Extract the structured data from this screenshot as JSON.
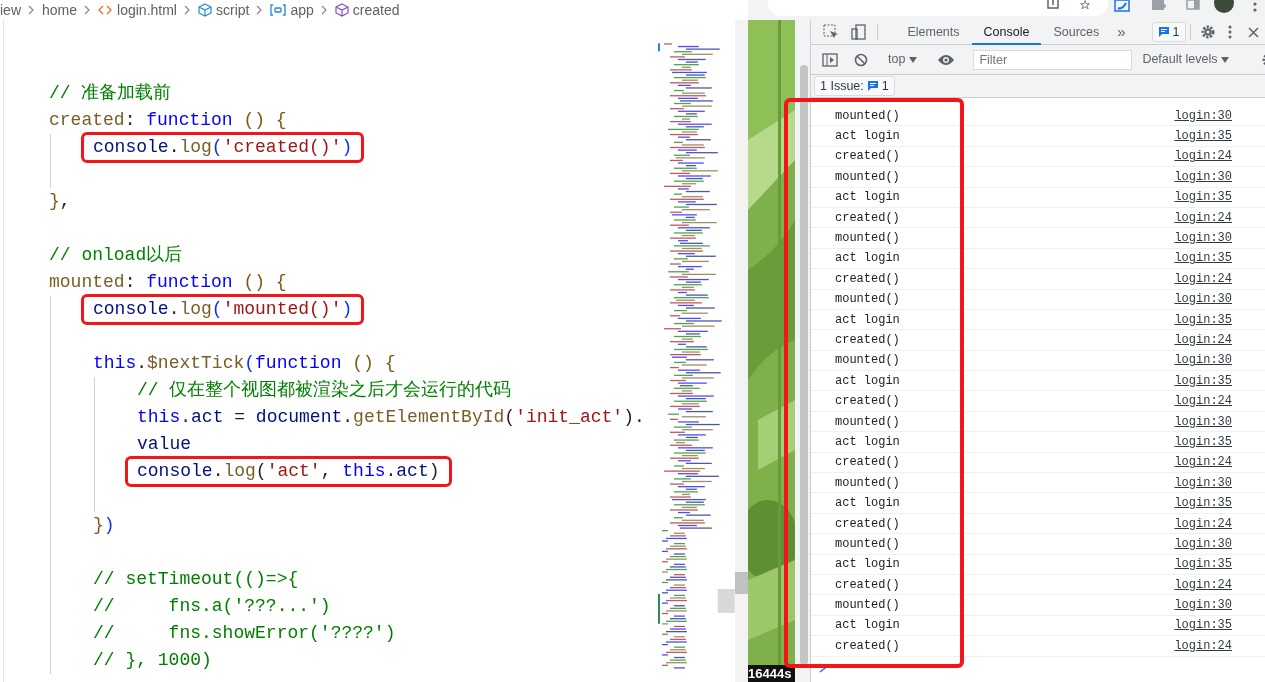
{
  "breadcrumb": [
    {
      "kind": "text",
      "label": "iew"
    },
    {
      "kind": "text",
      "label": "home"
    },
    {
      "kind": "html",
      "label": "login.html"
    },
    {
      "kind": "module",
      "label": "script"
    },
    {
      "kind": "variable",
      "label": "app"
    },
    {
      "kind": "method",
      "label": "created"
    }
  ],
  "code": [
    {
      "kind": "code",
      "highlighted": false,
      "tokens": [
        {
          "kind": "comment",
          "text": "// 准备加载前"
        }
      ]
    },
    {
      "kind": "code",
      "highlighted": false,
      "tokens": [
        {
          "kind": "key",
          "text": "created"
        },
        {
          "kind": "punct",
          "text": ": "
        },
        {
          "kind": "keyword",
          "text": "function"
        },
        {
          "kind": "paren",
          "text": " () {"
        }
      ],
      "children": [
        {
          "kind": "code",
          "highlighted": true,
          "tokens": [
            {
              "kind": "ident",
              "text": "console"
            },
            {
              "kind": "punct",
              "text": "."
            },
            {
              "kind": "method",
              "text": "log"
            },
            {
              "kind": "bracket",
              "text": "("
            },
            {
              "kind": "string",
              "text": "'created()'"
            },
            {
              "kind": "bracket",
              "text": ")"
            }
          ]
        },
        {
          "kind": "blank"
        }
      ]
    },
    {
      "kind": "code",
      "highlighted": false,
      "tokens": [
        {
          "kind": "paren",
          "text": "}"
        },
        {
          "kind": "punct",
          "text": ","
        }
      ]
    },
    {
      "kind": "blank"
    },
    {
      "kind": "code",
      "highlighted": false,
      "tokens": [
        {
          "kind": "comment",
          "text": "// onload以后"
        }
      ]
    },
    {
      "kind": "code",
      "highlighted": false,
      "tokens": [
        {
          "kind": "key",
          "text": "mounted"
        },
        {
          "kind": "punct",
          "text": ": "
        },
        {
          "kind": "keyword",
          "text": "function"
        },
        {
          "kind": "paren",
          "text": " () {"
        }
      ],
      "children": [
        {
          "kind": "code",
          "highlighted": true,
          "tokens": [
            {
              "kind": "ident",
              "text": "console"
            },
            {
              "kind": "punct",
              "text": "."
            },
            {
              "kind": "method",
              "text": "log"
            },
            {
              "kind": "bracket",
              "text": "("
            },
            {
              "kind": "string",
              "text": "'mounted()'"
            },
            {
              "kind": "bracket",
              "text": ")"
            }
          ]
        },
        {
          "kind": "blank"
        },
        {
          "kind": "code",
          "highlighted": false,
          "tokens": [
            {
              "kind": "keyword",
              "text": "this"
            },
            {
              "kind": "punct",
              "text": "."
            },
            {
              "kind": "method",
              "text": "$nextTick"
            },
            {
              "kind": "bracket",
              "text": "("
            },
            {
              "kind": "keyword",
              "text": "function"
            },
            {
              "kind": "paren",
              "text": " () {"
            }
          ],
          "children": [
            {
              "kind": "code",
              "highlighted": false,
              "tokens": [
                {
                  "kind": "comment",
                  "text": "// 仅在整个视图都被渲染之后才会运行的代码"
                }
              ]
            },
            {
              "kind": "code",
              "highlighted": false,
              "tokens": [
                {
                  "kind": "keyword",
                  "text": "this"
                },
                {
                  "kind": "punct",
                  "text": "."
                },
                {
                  "kind": "ident",
                  "text": "act"
                },
                {
                  "kind": "punct",
                  "text": " = "
                },
                {
                  "kind": "ident",
                  "text": "document"
                },
                {
                  "kind": "punct",
                  "text": "."
                },
                {
                  "kind": "method",
                  "text": "getElementById"
                },
                {
                  "kind": "punct",
                  "text": "("
                },
                {
                  "kind": "string",
                  "text": "'init_act'"
                },
                {
                  "kind": "punct",
                  "text": ")."
                }
              ]
            },
            {
              "kind": "code",
              "highlighted": false,
              "tokens": [
                {
                  "kind": "ident",
                  "text": "value"
                }
              ]
            },
            {
              "kind": "code",
              "highlighted": true,
              "tokens": [
                {
                  "kind": "ident",
                  "text": "console"
                },
                {
                  "kind": "punct",
                  "text": "."
                },
                {
                  "kind": "method",
                  "text": "log"
                },
                {
                  "kind": "punct",
                  "text": "("
                },
                {
                  "kind": "string",
                  "text": "'act'"
                },
                {
                  "kind": "punct",
                  "text": ", "
                },
                {
                  "kind": "keyword",
                  "text": "this"
                },
                {
                  "kind": "punct",
                  "text": "."
                },
                {
                  "kind": "ident",
                  "text": "act"
                },
                {
                  "kind": "punct",
                  "text": ")"
                }
              ]
            },
            {
              "kind": "blank"
            }
          ]
        },
        {
          "kind": "code",
          "highlighted": false,
          "tokens": [
            {
              "kind": "paren",
              "text": "}"
            },
            {
              "kind": "bracket",
              "text": ")"
            }
          ]
        },
        {
          "kind": "blank"
        },
        {
          "kind": "code",
          "highlighted": false,
          "tokens": [
            {
              "kind": "comment",
              "text": "// setTimeout(()=>{"
            }
          ]
        },
        {
          "kind": "code",
          "highlighted": false,
          "tokens": [
            {
              "kind": "comment",
              "text": "//     fns.a('???...')"
            }
          ]
        },
        {
          "kind": "code",
          "highlighted": false,
          "tokens": [
            {
              "kind": "comment",
              "text": "//     fns.showError('????')"
            }
          ]
        },
        {
          "kind": "code",
          "highlighted": false,
          "tokens": [
            {
              "kind": "comment",
              "text": "// }, 1000)"
            }
          ]
        }
      ]
    }
  ],
  "page_view": {
    "counter": "16444s"
  },
  "devtools": {
    "tabs": [
      {
        "label": "Elements",
        "selected": false
      },
      {
        "label": "Console",
        "selected": true
      },
      {
        "label": "Sources",
        "selected": false
      }
    ],
    "more": "»",
    "issues_badge": "1",
    "context": "top",
    "filter": {
      "placeholder": "Filter"
    },
    "levels": "Default levels",
    "issues_button": {
      "label": "1 Issue:",
      "count": "1"
    }
  },
  "console": {
    "highlighted": true,
    "messages": [
      {
        "text": "mounted()",
        "source": "login:30"
      },
      {
        "text": "act login",
        "source": "login:35"
      },
      {
        "text": "created()",
        "source": "login:24"
      },
      {
        "text": "mounted()",
        "source": "login:30"
      },
      {
        "text": "act login",
        "source": "login:35"
      },
      {
        "text": "created()",
        "source": "login:24"
      },
      {
        "text": "mounted()",
        "source": "login:30"
      },
      {
        "text": "act login",
        "source": "login:35"
      },
      {
        "text": "created()",
        "source": "login:24"
      },
      {
        "text": "mounted()",
        "source": "login:30"
      },
      {
        "text": "act login",
        "source": "login:35"
      },
      {
        "text": "created()",
        "source": "login:24"
      },
      {
        "text": "mounted()",
        "source": "login:30"
      },
      {
        "text": "act login",
        "source": "login:35"
      },
      {
        "text": "created()",
        "source": "login:24"
      },
      {
        "text": "mounted()",
        "source": "login:30"
      },
      {
        "text": "act login",
        "source": "login:35"
      },
      {
        "text": "created()",
        "source": "login:24"
      },
      {
        "text": "mounted()",
        "source": "login:30"
      },
      {
        "text": "act login",
        "source": "login:35"
      },
      {
        "text": "created()",
        "source": "login:24"
      },
      {
        "text": "mounted()",
        "source": "login:30"
      },
      {
        "text": "act login",
        "source": "login:35"
      },
      {
        "text": "created()",
        "source": "login:24"
      },
      {
        "text": "mounted()",
        "source": "login:30"
      },
      {
        "text": "act login",
        "source": "login:35"
      },
      {
        "text": "created()",
        "source": "login:24"
      }
    ]
  }
}
